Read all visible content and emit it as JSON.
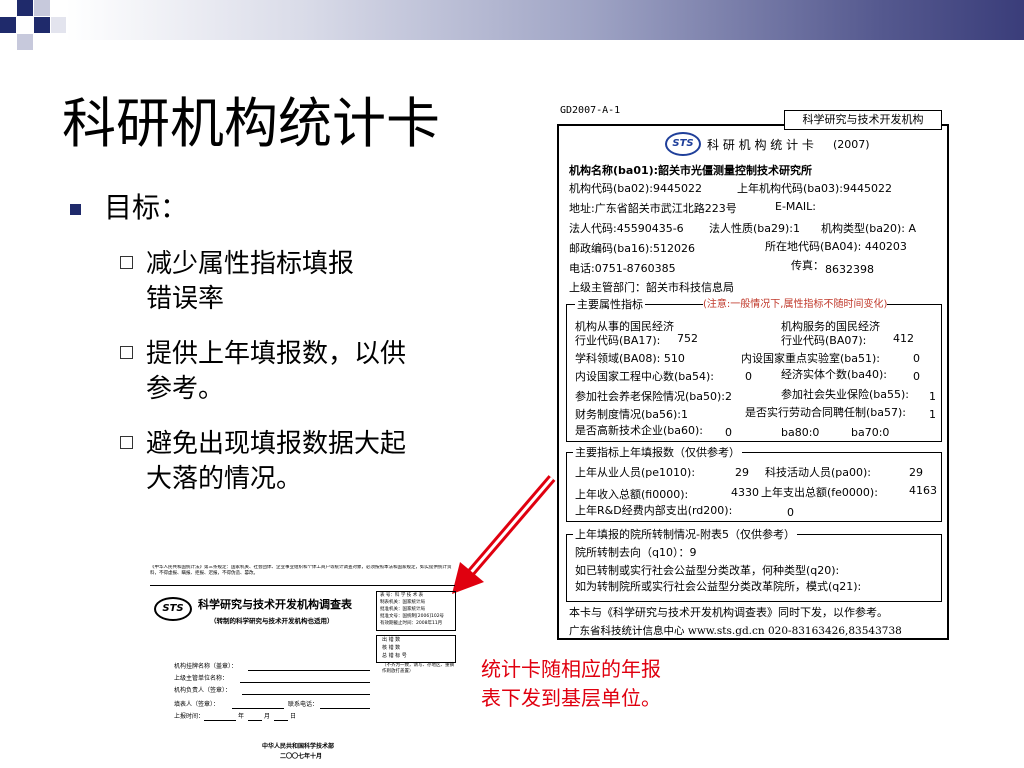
{
  "slide": {
    "title": "科研机构统计卡",
    "bullet": "目标：",
    "sub_items": [
      {
        "line1": "减少属性指标填报",
        "line2": "错误率"
      },
      {
        "line1": "提供上年填报数，以供",
        "line2": "参考。"
      },
      {
        "line1": "避免出现填报数据大起",
        "line2": "大落的情况。"
      }
    ],
    "caption": "统计卡随相应的年报表下发到基层单位。"
  },
  "colors": {
    "accent": "#1f2a6b",
    "caption": "#e0000f",
    "arrow": "#e0000f"
  },
  "card": {
    "code": "GD2007-A-1",
    "type_label": "科学研究与技术开发机构",
    "logo_text": "STS",
    "title": "科 研 机 构 统 计 卡",
    "year": "(2007)",
    "rows": {
      "name": "机构名称(ba01):韶关市光僵测量控制技术研究所",
      "code": "机构代码(ba02):9445022",
      "prev_code": "上年机构代码(ba03):9445022",
      "address": "地址:广东省韶关市武江北路223号",
      "email": "E-MAIL:",
      "legal_code": "法人代码:45590435-6",
      "legal_nature": "法人性质(ba29):1",
      "org_type": "机构类型(ba20): A",
      "postcode": "邮政编码(ba16):512026",
      "region": "所在地代码(BA04): 440203",
      "phone": "电话:0751-8760385",
      "fax_label": "传真：",
      "fax": "8632398",
      "superior": "上级主管部门：韶关市科技信息局"
    },
    "sec1": {
      "title": "主要属性指标",
      "note": "(注意:一般情况下,属性指标不随时间变化)",
      "l1a": "机构从事的国民经济",
      "l1b": "机构服务的国民经济",
      "l2a": "行业代码(BA17):",
      "l2a_val": "752",
      "l2b": "行业代码(BA07):",
      "l2b_val": "412",
      "l3a": "学科领域(BA08): 510",
      "l3b": "内设国家重点实验室(ba51):",
      "l3b_val": "0",
      "l4a": "内设国家工程中心数(ba54):",
      "l4a_val": "0",
      "l4b": "经济实体个数(ba40):",
      "l4b_val": "0",
      "l5a": "参加社会养老保险情况(ba50):2",
      "l5b": "参加社会失业保险(ba55):",
      "l5b_val": "1",
      "l6a": "财务制度情况(ba56):1",
      "l6b": "是否实行劳动合同聘任制(ba57):",
      "l6b_val": "1",
      "l7a": "是否高新技术企业(ba60):",
      "l7a_val": "0",
      "l7b": "ba80:0",
      "l7c": "ba70:0"
    },
    "sec2": {
      "title": "主要指标上年填报数（仅供参考）",
      "l1a": "上年从业人员(pe1010):",
      "l1a_val": "29",
      "l1b": "科技活动人员(pa00):",
      "l1b_val": "29",
      "l2a": "上年收入总额(fi0000):",
      "l2a_val": "4330",
      "l2b": "上年支出总额(fe0000):",
      "l2b_val": "4163",
      "l3a": "上年R&D经费内部支出(rd200):",
      "l3a_val": "0"
    },
    "sec3": {
      "title": "上年填报的院所转制情况-附表5（仅供参考）",
      "l1": "院所转制去向（q10）：9",
      "l2": "如已转制或实行社会公益型分类改革，何种类型(q20):",
      "l3": "如为转制院所或实行社会公益型分类改革院所，模式(q21):"
    },
    "footer1": "本卡与《科学研究与技术开发机构调查表》同时下发，以作参考。",
    "footer2": "广东省科技统计信息中心 www.sts.gd.cn 020-83163426,83543738"
  },
  "cover": {
    "header": "《中华人民共和国统计法》第三条规定：国家机关、社会团体、企业事业组织和个体工商户等统计调查对象，必须按照本法和国家规定，如实提供统计资料，不得虚报、瞒报、拒报、迟报，不得伪造、篡改。",
    "logo_text": "STS",
    "title": "科学研究与技术开发机构调查表",
    "subtitle": "（转制的科学研究与技术开发机构也适用）",
    "meta": [
      "表 号：科 学 技 术 表",
      "制表机关：国家统计局",
      "批准机关：国家统计局",
      "批准文号：国统制[2006]102号",
      "有效期截止时间：2008年11月"
    ],
    "checks": [
      "出 错 数",
      "核 错 数",
      "总 错 标 号"
    ],
    "fields": [
      "机构挂牌名称（盖章）：",
      "上级主管单位名称：",
      "机构负责人（签章）：",
      "填表人（签章）：",
      "上报时间："
    ],
    "contact": "联系电话：",
    "date_parts": [
      "年",
      "月",
      "日"
    ],
    "note": "（不齐为一致，请写、存地区、重镇作则放打盖置）",
    "ministry": "中华人民共和国科学技术部",
    "date": "二〇〇七年十月"
  }
}
